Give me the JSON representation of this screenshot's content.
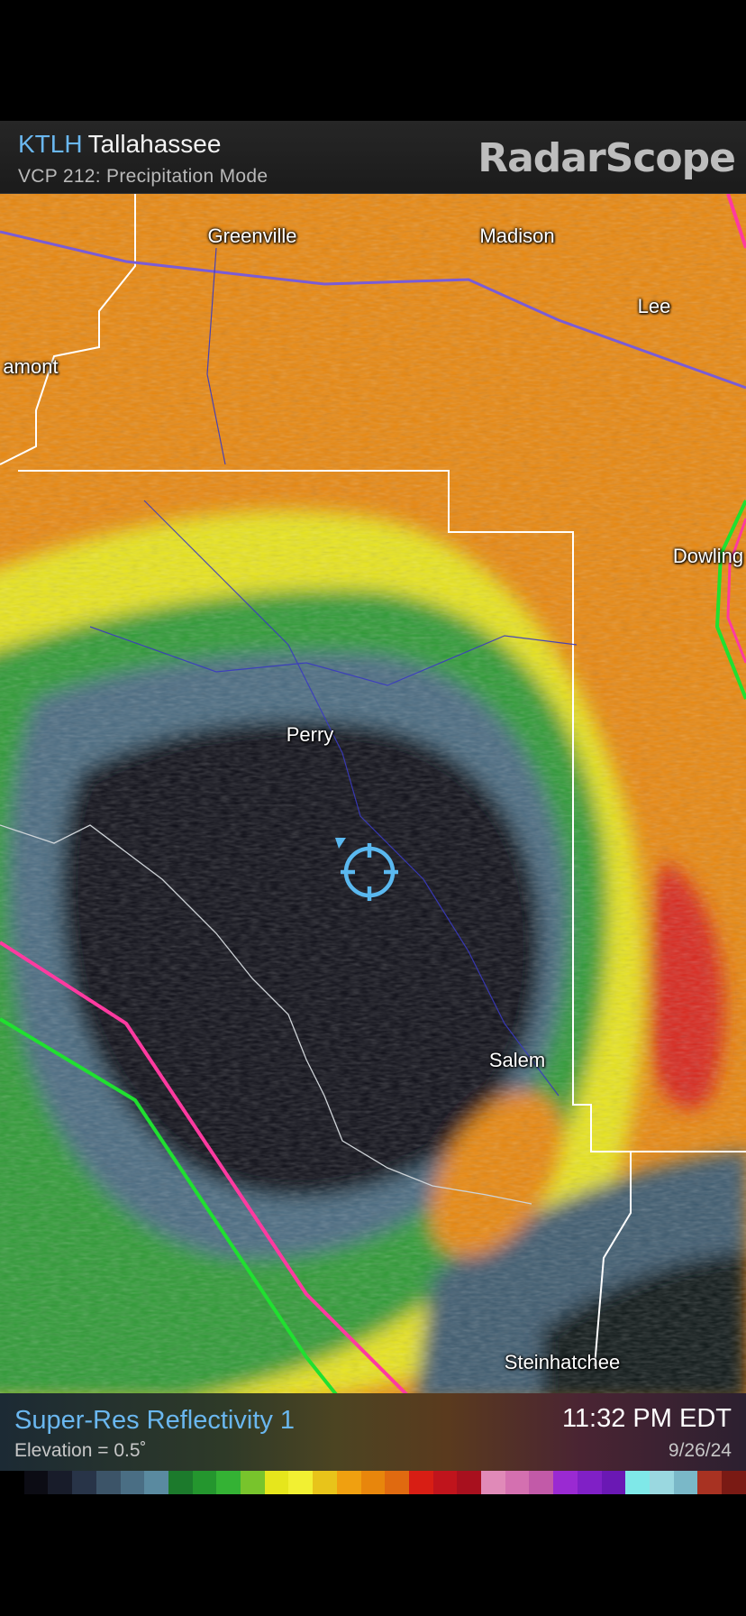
{
  "header": {
    "station_code": "KTLH",
    "station_name": "Tallahassee",
    "vcp_mode": "VCP 212: Precipitation Mode",
    "brand": "RadarScope"
  },
  "map": {
    "cities": {
      "greenville": "Greenville",
      "madison": "Madison",
      "lee": "Lee",
      "lamont": "amont",
      "dowling": "Dowling",
      "perry": "Perry",
      "salem": "Salem",
      "steinhatchee": "Steinhatchee"
    },
    "location_marker": "crosshair-location-icon"
  },
  "footer": {
    "product": "Super-Res Reflectivity 1",
    "elevation": "Elevation = 0.5˚",
    "time": "11:32 PM EDT",
    "date": "9/26/24"
  },
  "legend": {
    "colors": [
      "#000000",
      "#0c0c14",
      "#181c2a",
      "#283448",
      "#3c5468",
      "#4a6e84",
      "#5a8aa0",
      "#1c7a2c",
      "#24962e",
      "#34b234",
      "#78c42c",
      "#e6e61c",
      "#f2f032",
      "#e8c41a",
      "#f0a010",
      "#e8860c",
      "#e06a10",
      "#d81e14",
      "#c0141c",
      "#a8101e",
      "#e08ab8",
      "#d470b0",
      "#c25aa8",
      "#9a2ad2",
      "#8020c6",
      "#6a18b4",
      "#7fe8e8",
      "#9ad8e0",
      "#7ab8c8",
      "#a83222",
      "#7a1a14"
    ]
  }
}
